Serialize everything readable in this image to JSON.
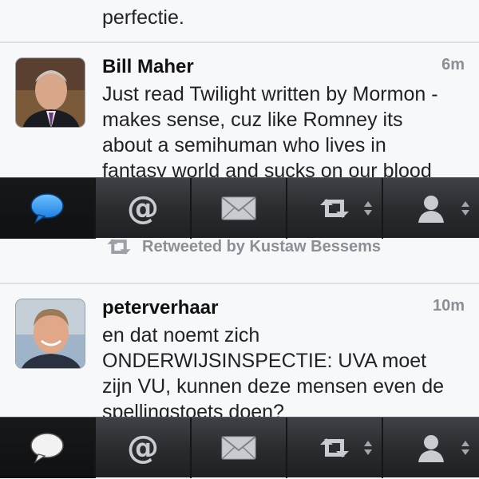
{
  "timeline": {
    "top_fragment": "perfectie.",
    "tweets": [
      {
        "name": "Bill Maher",
        "time": "6m",
        "lines": [
          "Just read Twilight written by Mormon -",
          "makes sense, cuz like Romney its",
          "about a semihuman who lives in",
          "fantasy world and sucks on our blood"
        ]
      },
      {
        "name": "peterverhaar",
        "time": "10m",
        "retweeted_by": "Retweeted by Kustaw Bessems",
        "lines": [
          "en dat noemt zich",
          "ONDERWIJSINSPECTIE: UVA moet",
          "zijn VU, kunnen deze mensen even de",
          "spellingstoets doen?"
        ]
      }
    ]
  },
  "toolbar": {
    "buttons": [
      {
        "icon": "speech-bubble-icon"
      },
      {
        "icon": "at-icon",
        "glyph": "@"
      },
      {
        "icon": "envelope-icon"
      },
      {
        "icon": "retweet-icon"
      },
      {
        "icon": "person-icon"
      }
    ]
  },
  "colors": {
    "active_bubble_top": "#1f8de8",
    "accent_text": "#222222",
    "muted_text": "#8a8f96",
    "toolbar_bg": "#2a2d30"
  }
}
